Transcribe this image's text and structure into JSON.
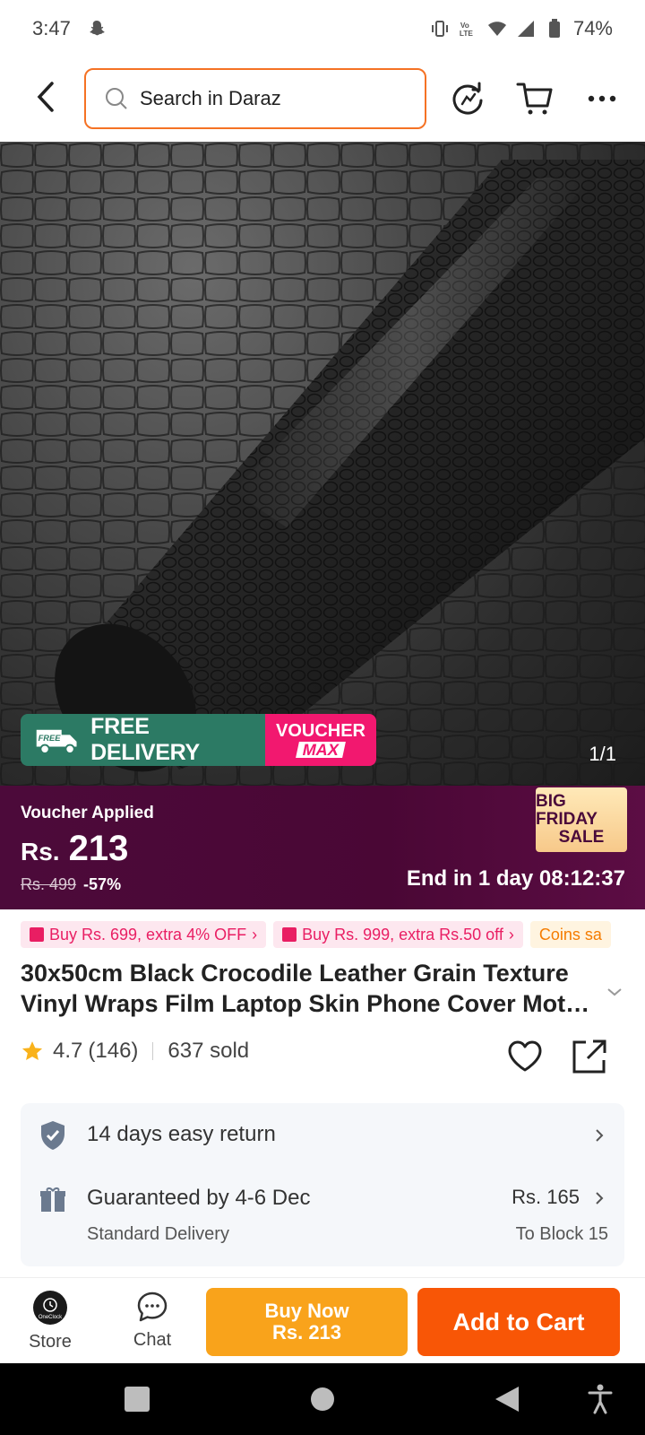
{
  "status_bar": {
    "time": "3:47",
    "battery": "74%",
    "icons": [
      "snapchat-icon",
      "vibrate-icon",
      "volte-icon",
      "wifi-icon",
      "signal-icon",
      "battery-icon"
    ]
  },
  "header": {
    "search_placeholder": "Search in Daraz",
    "icons": [
      "back-icon",
      "search-icon",
      "share-refresh-icon",
      "cart-icon",
      "more-icon"
    ]
  },
  "product_image": {
    "counter": "1/1",
    "promo_free_delivery": "FREE DELIVERY",
    "promo_free_tag": "FREE",
    "promo_voucher_top": "VOUCHER",
    "promo_voucher_bottom": "MAX"
  },
  "price_bar": {
    "voucher_applied": "Voucher Applied",
    "currency": "Rs.",
    "price": "213",
    "old_price": "Rs. 499",
    "discount": "-57%",
    "timer": "End in 1 day 08:12:37",
    "badge_line1": "BIG FRIDAY",
    "badge_line2": "SALE"
  },
  "chips": [
    {
      "label": "Buy Rs. 699, extra 4% OFF"
    },
    {
      "label": "Buy Rs. 999, extra Rs.50 off"
    },
    {
      "label": "Coins sa"
    }
  ],
  "product": {
    "title": "30x50cm Black Crocodile Leather Grain Texture Vinyl Wraps Film Laptop Skin Phone Cover Mot…",
    "rating": "4.7",
    "reviews": "(146)",
    "sold": "637 sold"
  },
  "services": {
    "return_label": "14 days easy return",
    "delivery_label": "Guaranteed by 4-6 Dec",
    "delivery_sub": "Standard Delivery",
    "delivery_price": "Rs. 165",
    "delivery_location": "To Block 15"
  },
  "action_bar": {
    "store_label": "Store",
    "chat_label": "Chat",
    "buy_now_line1": "Buy Now",
    "buy_now_line2": "Rs. 213",
    "add_to_cart": "Add to Cart",
    "store_logo_text": "OneClock"
  },
  "colors": {
    "accent": "#f57224",
    "buy_now": "#f9a31b",
    "add_to_cart": "#f85606",
    "price_bar": "#4a0735",
    "free_delivery": "#2c7a64",
    "voucher": "#f2186f"
  }
}
